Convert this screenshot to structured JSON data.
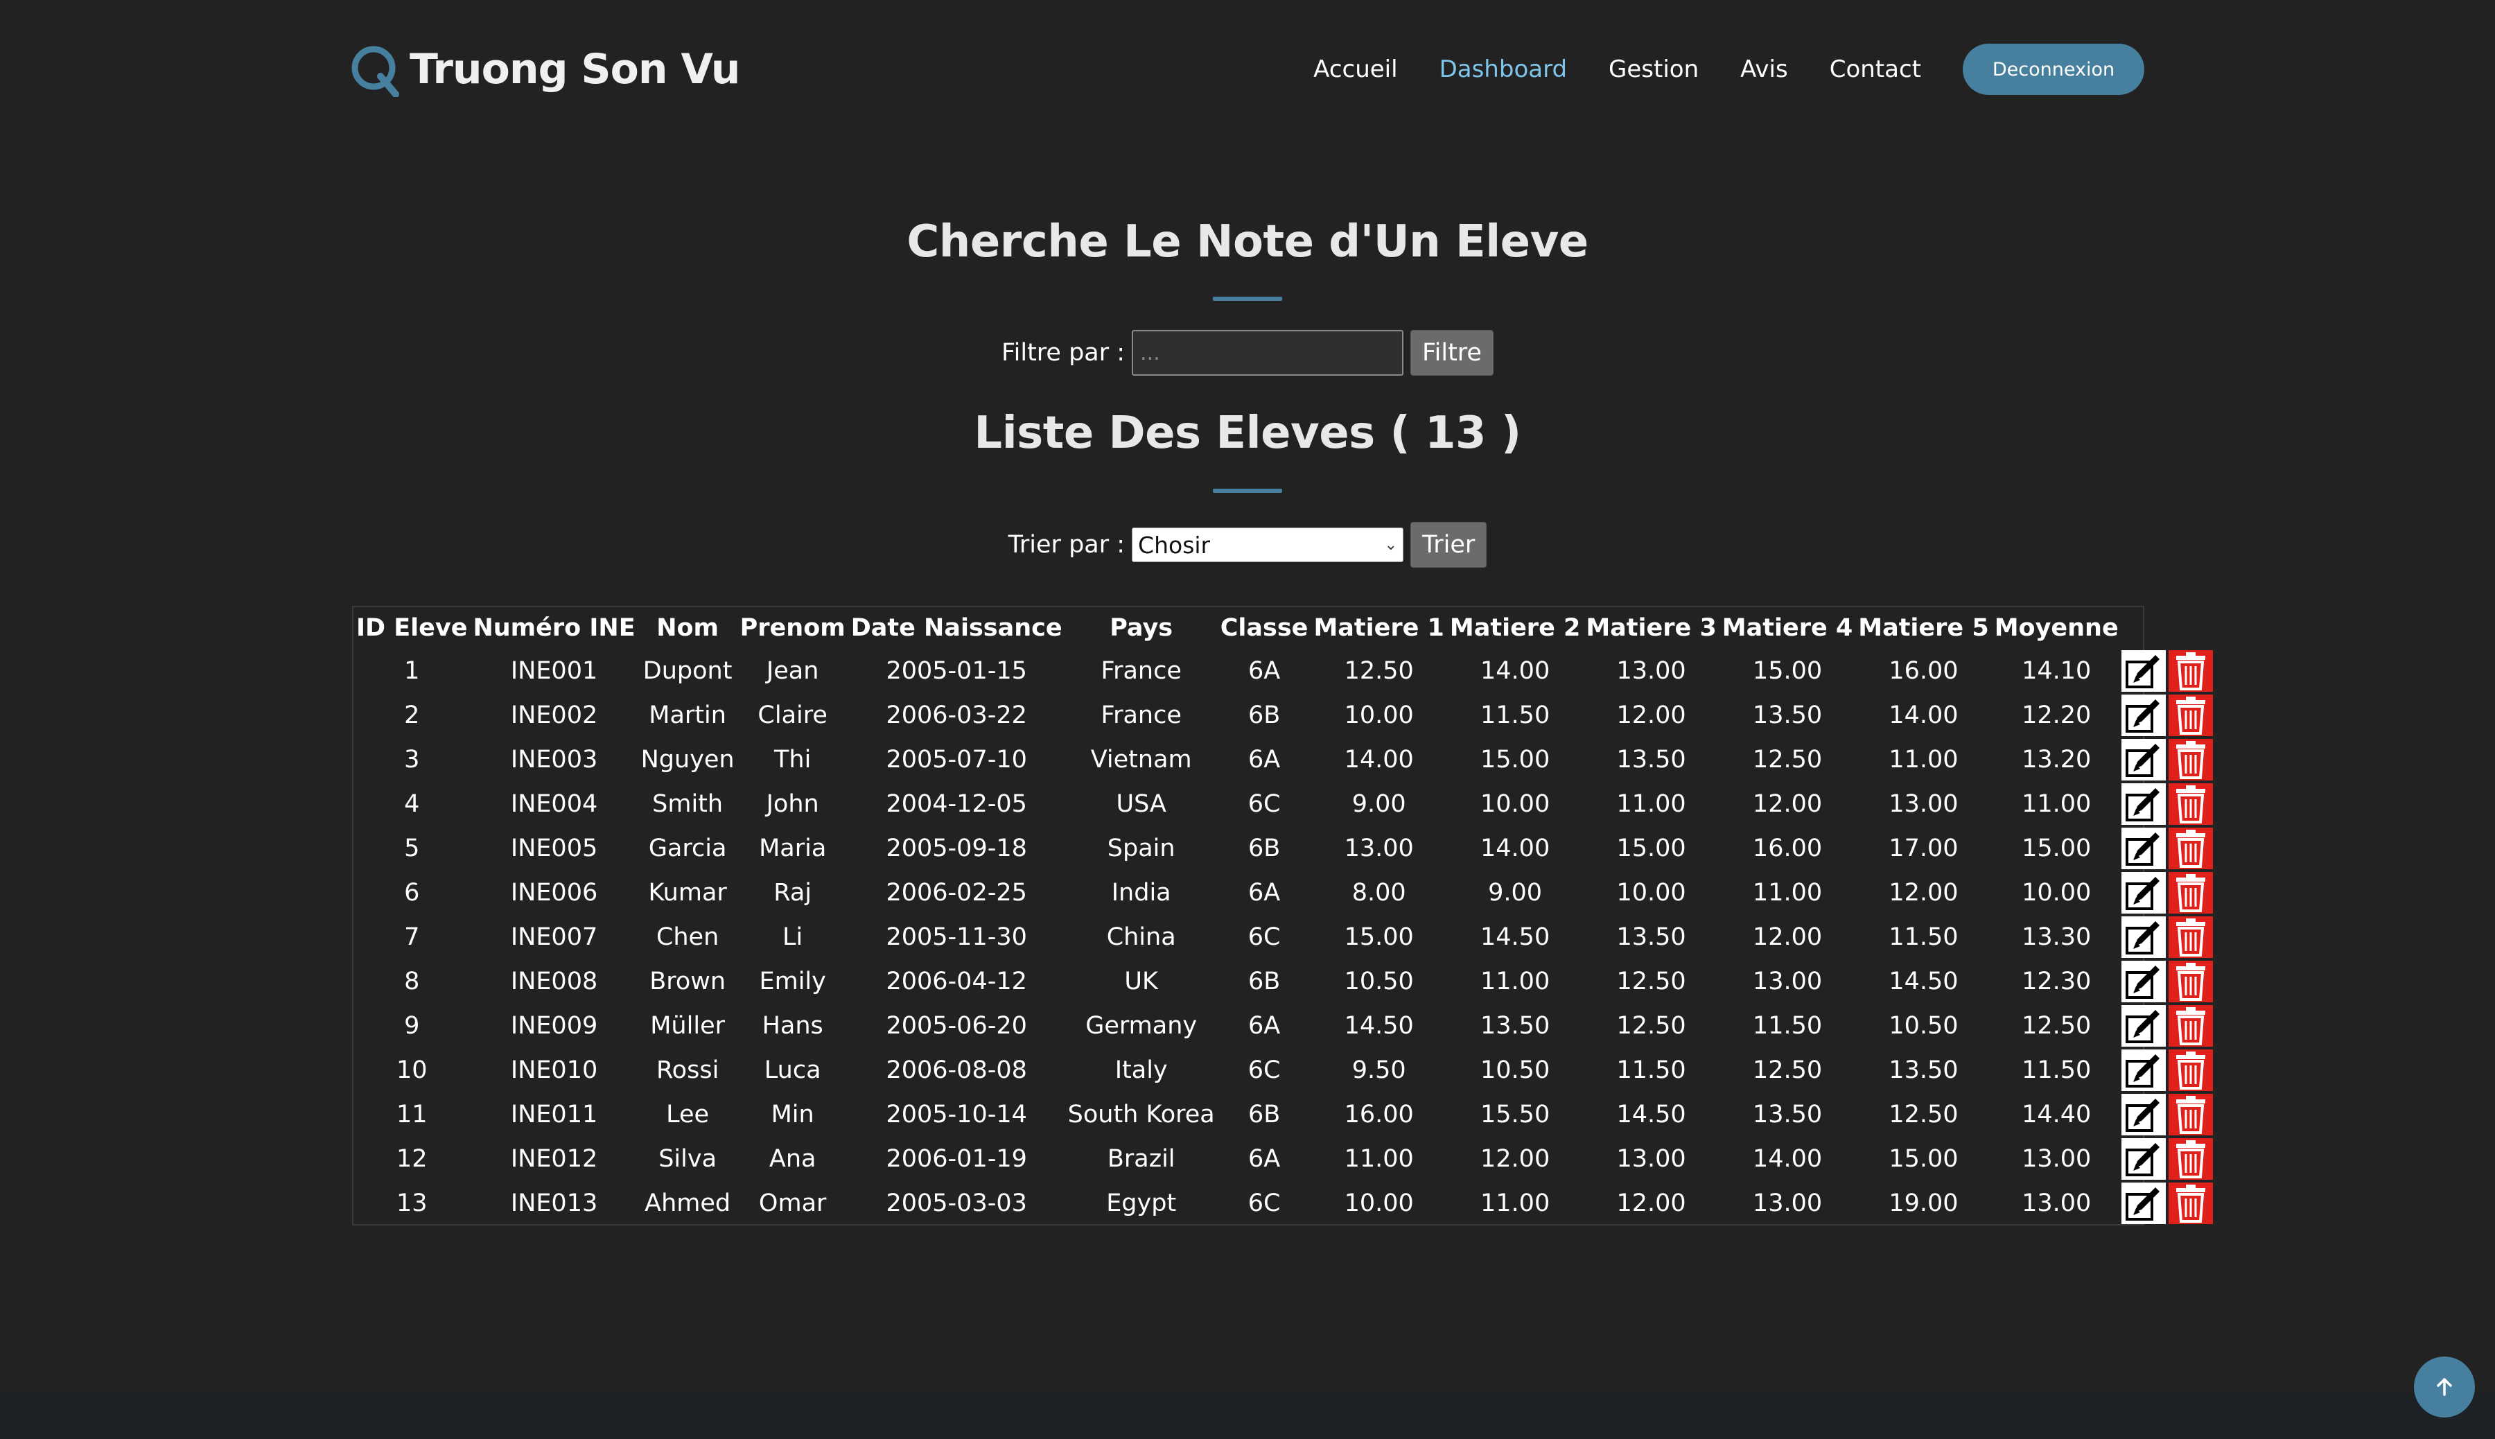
{
  "brand": {
    "name": "Truong Son Vu",
    "icon": "q-logo-icon",
    "accent": "#47809e"
  },
  "nav": {
    "items": [
      {
        "label": "Accueil",
        "active": false
      },
      {
        "label": "Dashboard",
        "active": true
      },
      {
        "label": "Gestion",
        "active": false
      },
      {
        "label": "Avis",
        "active": false
      },
      {
        "label": "Contact",
        "active": false
      }
    ],
    "logout_label": "Deconnexion"
  },
  "search": {
    "title": "Cherche Le Note d'Un Eleve",
    "label": "Filtre par :",
    "placeholder": "...",
    "value": "",
    "button": "Filtre"
  },
  "list": {
    "title": "Liste Des Eleves ( 13 )",
    "sort_label": "Trier par :",
    "sort_selected": "Chosir",
    "sort_button": "Trier"
  },
  "table": {
    "columns": [
      "ID Eleve",
      "Numéro INE",
      "Nom",
      "Prenom",
      "Date Naissance",
      "Pays",
      "Classe",
      "Matiere 1",
      "Matiere 2",
      "Matiere 3",
      "Matiere 4",
      "Matiere 5",
      "Moyenne",
      ""
    ],
    "rows": [
      [
        "1",
        "INE001",
        "Dupont",
        "Jean",
        "2005-01-15",
        "France",
        "6A",
        "12.50",
        "14.00",
        "13.00",
        "15.00",
        "16.00",
        "14.10"
      ],
      [
        "2",
        "INE002",
        "Martin",
        "Claire",
        "2006-03-22",
        "France",
        "6B",
        "10.00",
        "11.50",
        "12.00",
        "13.50",
        "14.00",
        "12.20"
      ],
      [
        "3",
        "INE003",
        "Nguyen",
        "Thi",
        "2005-07-10",
        "Vietnam",
        "6A",
        "14.00",
        "15.00",
        "13.50",
        "12.50",
        "11.00",
        "13.20"
      ],
      [
        "4",
        "INE004",
        "Smith",
        "John",
        "2004-12-05",
        "USA",
        "6C",
        "9.00",
        "10.00",
        "11.00",
        "12.00",
        "13.00",
        "11.00"
      ],
      [
        "5",
        "INE005",
        "Garcia",
        "Maria",
        "2005-09-18",
        "Spain",
        "6B",
        "13.00",
        "14.00",
        "15.00",
        "16.00",
        "17.00",
        "15.00"
      ],
      [
        "6",
        "INE006",
        "Kumar",
        "Raj",
        "2006-02-25",
        "India",
        "6A",
        "8.00",
        "9.00",
        "10.00",
        "11.00",
        "12.00",
        "10.00"
      ],
      [
        "7",
        "INE007",
        "Chen",
        "Li",
        "2005-11-30",
        "China",
        "6C",
        "15.00",
        "14.50",
        "13.50",
        "12.00",
        "11.50",
        "13.30"
      ],
      [
        "8",
        "INE008",
        "Brown",
        "Emily",
        "2006-04-12",
        "UK",
        "6B",
        "10.50",
        "11.00",
        "12.50",
        "13.00",
        "14.50",
        "12.30"
      ],
      [
        "9",
        "INE009",
        "Müller",
        "Hans",
        "2005-06-20",
        "Germany",
        "6A",
        "14.50",
        "13.50",
        "12.50",
        "11.50",
        "10.50",
        "12.50"
      ],
      [
        "10",
        "INE010",
        "Rossi",
        "Luca",
        "2006-08-08",
        "Italy",
        "6C",
        "9.50",
        "10.50",
        "11.50",
        "12.50",
        "13.50",
        "11.50"
      ],
      [
        "11",
        "INE011",
        "Lee",
        "Min",
        "2005-10-14",
        "South Korea",
        "6B",
        "16.00",
        "15.50",
        "14.50",
        "13.50",
        "12.50",
        "14.40"
      ],
      [
        "12",
        "INE012",
        "Silva",
        "Ana",
        "2006-01-19",
        "Brazil",
        "6A",
        "11.00",
        "12.00",
        "13.00",
        "14.00",
        "15.00",
        "13.00"
      ],
      [
        "13",
        "INE013",
        "Ahmed",
        "Omar",
        "2005-03-03",
        "Egypt",
        "6C",
        "10.00",
        "11.00",
        "12.00",
        "13.00",
        "19.00",
        "13.00"
      ]
    ],
    "row_actions": {
      "edit_icon": "edit-icon",
      "delete_icon": "trash-icon"
    }
  },
  "scroll_top": {
    "icon": "arrow-up-icon"
  }
}
